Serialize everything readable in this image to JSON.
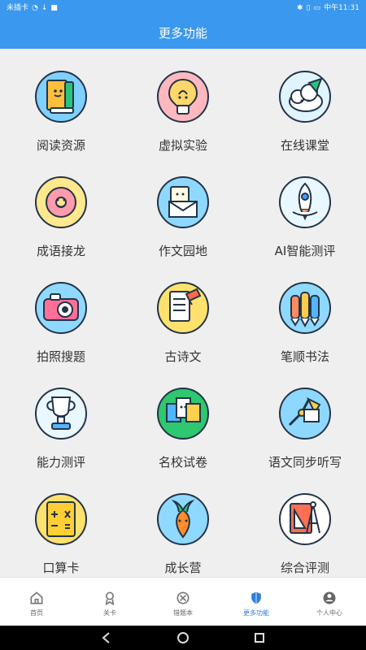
{
  "status": {
    "left_text": "未插卡",
    "right_time": "中午11:31"
  },
  "header": {
    "title": "更多功能"
  },
  "grid": {
    "items": [
      {
        "label": "阅读资源",
        "icon": "reading-icon"
      },
      {
        "label": "虚拟实验",
        "icon": "lightbulb-icon"
      },
      {
        "label": "在线课堂",
        "icon": "online-class-icon"
      },
      {
        "label": "成语接龙",
        "icon": "donut-icon"
      },
      {
        "label": "作文园地",
        "icon": "envelope-icon"
      },
      {
        "label": "AI智能测评",
        "icon": "rocket-icon"
      },
      {
        "label": "拍照搜题",
        "icon": "camera-icon"
      },
      {
        "label": "古诗文",
        "icon": "notebook-icon"
      },
      {
        "label": "笔顺书法",
        "icon": "pencils-icon"
      },
      {
        "label": "能力测评",
        "icon": "trophy-icon"
      },
      {
        "label": "名校试卷",
        "icon": "papers-icon"
      },
      {
        "label": "语文同步听写",
        "icon": "lamp-icon"
      },
      {
        "label": "口算卡",
        "icon": "calculator-icon"
      },
      {
        "label": "成长营",
        "icon": "carrot-icon"
      },
      {
        "label": "综合评测",
        "icon": "compass-icon"
      }
    ]
  },
  "tabbar": {
    "items": [
      {
        "label": "首页",
        "icon": "home-icon",
        "active": false
      },
      {
        "label": "关卡",
        "icon": "badge-icon",
        "active": false
      },
      {
        "label": "错题本",
        "icon": "error-book-icon",
        "active": false
      },
      {
        "label": "更多功能",
        "icon": "shield-icon",
        "active": true
      },
      {
        "label": "个人中心",
        "icon": "user-icon",
        "active": false
      }
    ]
  },
  "colors": {
    "primary": "#3a98ee",
    "active_tab": "#2f7fdc"
  }
}
